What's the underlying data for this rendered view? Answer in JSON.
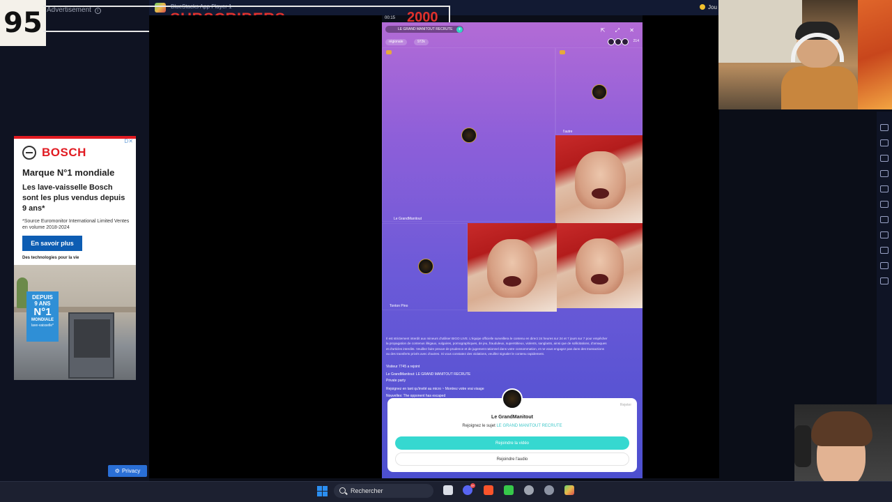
{
  "overlay": {
    "counter": "95",
    "ad_label": "Advertisement",
    "ad_info": "i",
    "subscribers_label": "SUBSCRIBERS",
    "subscribers_count": "2000",
    "bluestacks_title": "BlueStacks App Player 1",
    "time": "00:15"
  },
  "ad": {
    "corner": "D✕",
    "brand": "BOSCH",
    "headline": "Marque N°1 mondiale",
    "subheadline": "Les lave-vaisselle Bosch sont les plus vendus depuis 9 ans*",
    "footnote": "*Source Euromonitor International Limited Ventes en volume 2018-2024",
    "cta": "En savoir plus",
    "tagline": "Des technologies pour la vie",
    "badge_line1": "DEPUIS",
    "badge_line2": "9 ANS",
    "badge_line3": "N°1",
    "badge_line4": "MONDIALE",
    "badge_line5": "lave-vaisselle*"
  },
  "privacy": {
    "label": "Privacy"
  },
  "top_right": {
    "label": "Jou"
  },
  "room": {
    "title": "LE GRAND MANITOUT RECRUTE",
    "plus": "+",
    "tag_region": "régionale",
    "tag_count": "972k",
    "viewers": "214",
    "top_icons": "⇱ ⤢ ✕",
    "seats": [
      {
        "name": "Le GrandManitout"
      },
      {
        "name": "l'autre"
      },
      {
        "name": "Tonton Pino"
      }
    ],
    "rules": "Il est strictement interdit aux mineurs d'utiliser BIGO LIVE. L'équipe officielle surveillera le contenu en direct 24 heures sur 24 et 7 jours sur 7 pour empêcher la propagation de contenus illégaux, vulgaires, pornographiques, de jeu, frauduleux, superstitieux, violents, sanglants, ainsi que de sollicitations, d'arnaques et d'articles interdits. Veuillez faire preuve de prudence et de jugement rationnel dans votre consommation, et ne vous engagez pas dans des transactions ou des transferts privés avec d'autres. Si vous constatez des violations, veuillez signaler le contenu rapidement.",
    "chat": [
      "Visiteur 7745 a rejoint",
      "Le GrandManitout: LE GRAND MANITOUT RECRUTE",
      "Private party",
      "Rejoignez en tant qu'invité au micro ~ Montrez votre vrai visage",
      "Nouvelles: The opponent has escaped"
    ]
  },
  "dialog": {
    "skip": "Rejeter",
    "name": "Le GrandManitout",
    "subject_prefix": "Rejoignez le sujet",
    "subject": "LE GRAND MANITOUT RECRUTE",
    "video_btn": "Rejoindre la vidéo",
    "audio_btn": "Rejoindre l'audio"
  },
  "taskbar": {
    "search_placeholder": "Rechercher",
    "discord_badge": "9+"
  }
}
